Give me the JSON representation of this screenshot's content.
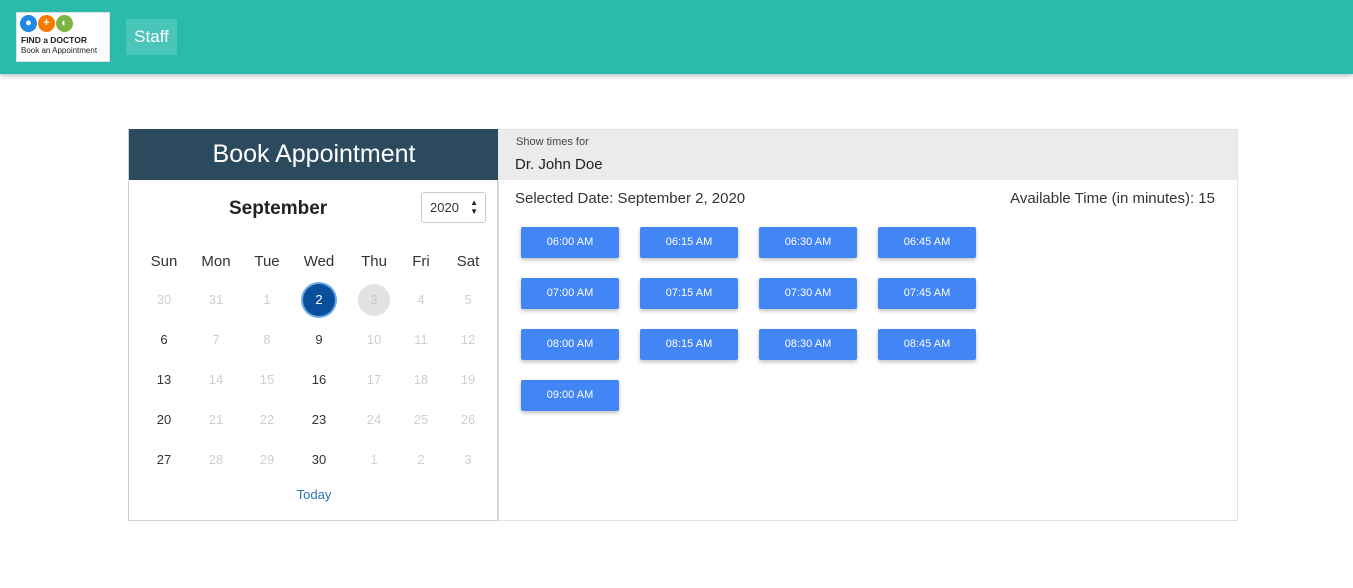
{
  "header": {
    "logo": {
      "line1": "FIND a DOCTOR",
      "line2": "Book an Appointment",
      "icons": [
        "search-icon",
        "plus-icon",
        "clock-icon"
      ]
    },
    "nav_staff": "Staff",
    "bg_color": "#2bbbad"
  },
  "calendar": {
    "title": "Book Appointment",
    "month": "September",
    "year": "2020",
    "weekdays": [
      "Sun",
      "Mon",
      "Tue",
      "Wed",
      "Thu",
      "Fri",
      "Sat"
    ],
    "weeks": [
      [
        "30",
        "31",
        "1",
        "2",
        "3",
        "4",
        "5"
      ],
      [
        "6",
        "7",
        "8",
        "9",
        "10",
        "11",
        "12"
      ],
      [
        "13",
        "14",
        "15",
        "16",
        "17",
        "18",
        "19"
      ],
      [
        "20",
        "21",
        "22",
        "23",
        "24",
        "25",
        "26"
      ],
      [
        "27",
        "28",
        "29",
        "30",
        "1",
        "2",
        "3"
      ]
    ],
    "today_link": "Today",
    "selected_day": "2",
    "today_day": "3",
    "accent_color": "#2c4a5e"
  },
  "schedule": {
    "show_times_label": "Show times for",
    "doctor": "Dr. John Doe",
    "selected_date": "Selected Date: September 2, 2020",
    "available_time": "Available Time (in minutes): 15",
    "slots": [
      "06:00 AM",
      "06:15 AM",
      "06:30 AM",
      "06:45 AM",
      "07:00 AM",
      "07:15 AM",
      "07:30 AM",
      "07:45 AM",
      "08:00 AM",
      "08:15 AM",
      "08:30 AM",
      "08:45 AM",
      "09:00 AM"
    ],
    "slot_color": "#4285f4"
  }
}
